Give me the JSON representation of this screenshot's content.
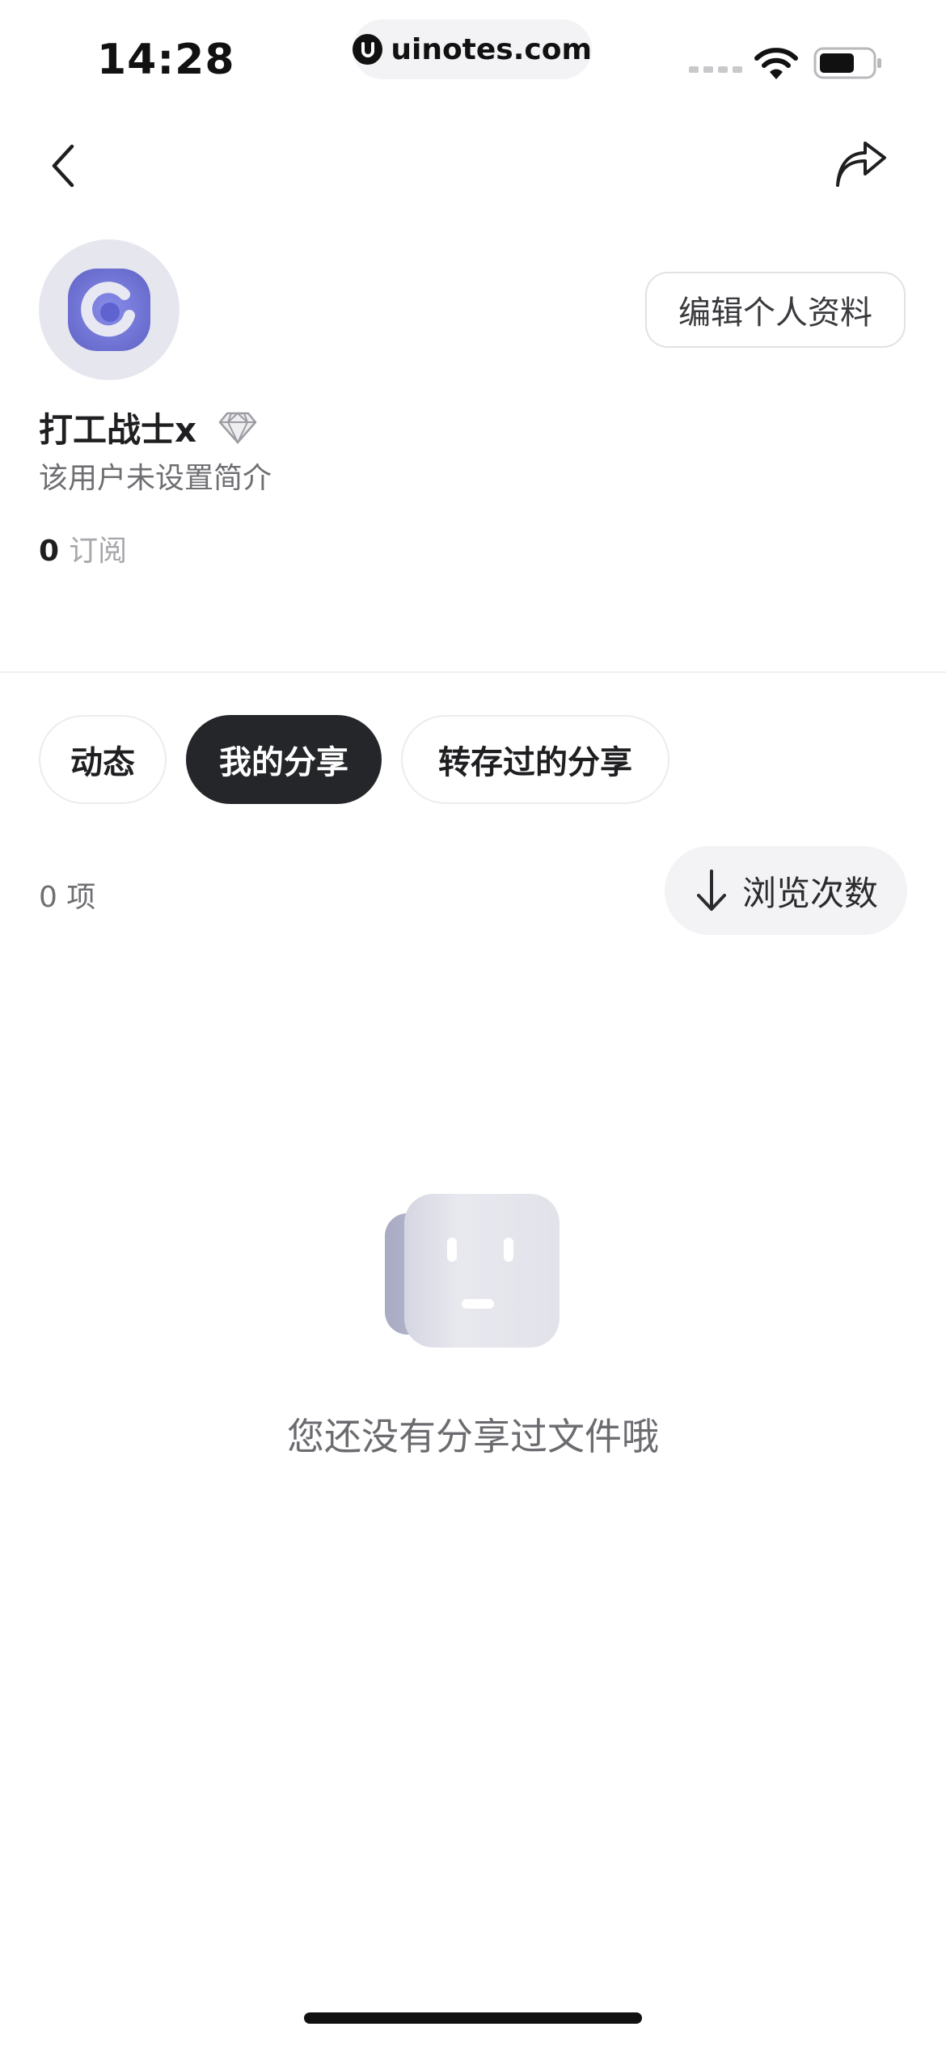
{
  "status_bar": {
    "time": "14:28",
    "url": "uinotes.com"
  },
  "nav": {
    "back_icon": "chevron-left-icon",
    "share_icon": "share-arrow-icon"
  },
  "profile": {
    "username": "打工战士x",
    "badge_icon": "diamond-icon",
    "bio": "该用户未设置简介",
    "subscriptions_count": "0",
    "subscriptions_label": "订阅",
    "edit_button": "编辑个人资料",
    "avatar_color": "#6b6fd6"
  },
  "tabs": [
    {
      "label": "动态",
      "active": false
    },
    {
      "label": "我的分享",
      "active": true
    },
    {
      "label": "转存过的分享",
      "active": false
    }
  ],
  "list_header": {
    "count_text": "0 项",
    "sort_label": "浏览次数",
    "sort_icon": "arrow-down-icon"
  },
  "empty_state": {
    "message": "您还没有分享过文件哦",
    "illustration_icon": "empty-box-face-icon"
  }
}
